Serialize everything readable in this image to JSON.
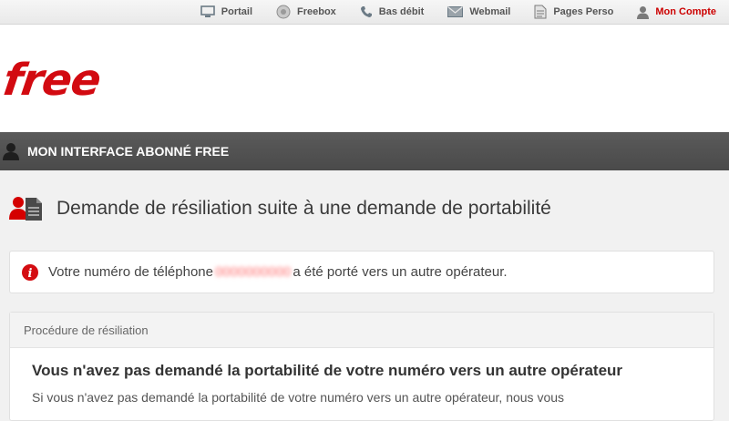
{
  "nav": {
    "items": [
      {
        "label": "Portail",
        "icon": "monitor-icon"
      },
      {
        "label": "Freebox",
        "icon": "freebox-icon"
      },
      {
        "label": "Bas débit",
        "icon": "phone-icon"
      },
      {
        "label": "Webmail",
        "icon": "mail-icon"
      },
      {
        "label": "Pages Perso",
        "icon": "pages-icon"
      },
      {
        "label": "Mon Compte",
        "icon": "user-icon",
        "active": true
      }
    ]
  },
  "logo": {
    "text": "free"
  },
  "subscriber_bar": {
    "title": "MON INTERFACE ABONNÉ FREE"
  },
  "page": {
    "title": "Demande de résiliation suite à une demande de portabilité"
  },
  "alert": {
    "text_before": "Votre numéro de téléphone",
    "redacted_number": "0000000000",
    "text_after": "a été porté vers un autre opérateur."
  },
  "panel": {
    "header": "Procédure de résiliation",
    "heading": "Vous n'avez pas demandé la portabilité de votre numéro vers un autre opérateur",
    "body": "Si vous n'avez pas demandé la portabilité de votre numéro vers un autre opérateur, nous vous"
  },
  "colors": {
    "brand": "#d20a11",
    "active_nav": "#cc0000",
    "bar": "#4f4f4f"
  }
}
